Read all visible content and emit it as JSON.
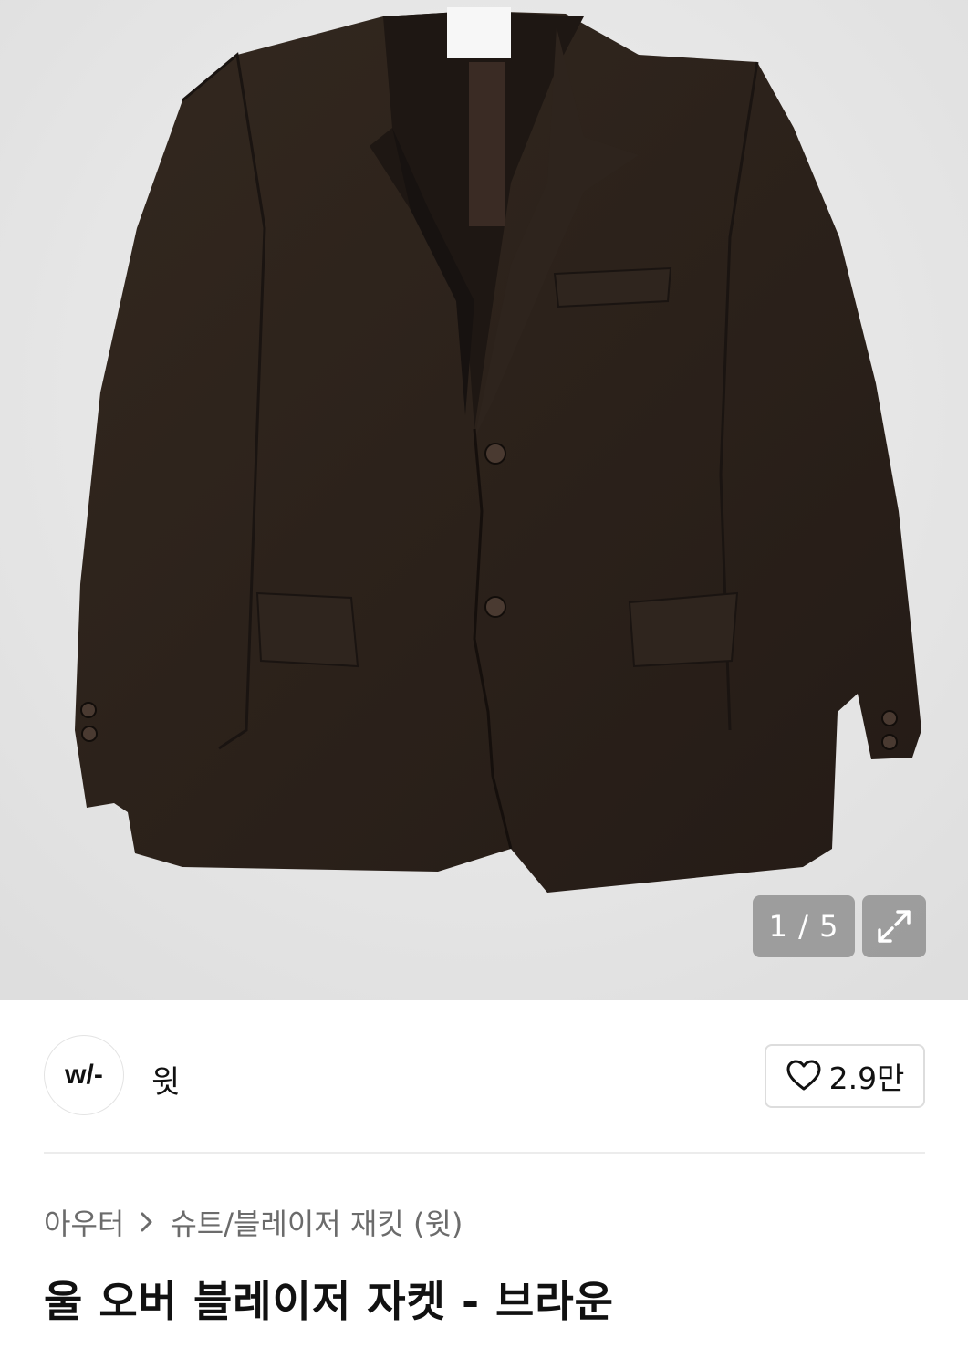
{
  "product_image": {
    "description_icon": "jacket-photo",
    "counter_current": "1",
    "counter_total": "5",
    "counter_text": "1 / 5",
    "expand_icon": "expand-icon"
  },
  "brand": {
    "logo_text": "w/-",
    "name": "윗"
  },
  "like": {
    "icon": "heart-icon",
    "count": "2.9만"
  },
  "breadcrumb": {
    "items": [
      "아우터",
      "슈트/블레이저 재킷 (윗)"
    ],
    "separator_icon": "chevron-right-icon"
  },
  "product": {
    "title": "울 오버 블레이저 자켓 - 브라운"
  },
  "colors": {
    "hero_bg": "#e9e9e9",
    "jacket": "#2b211b",
    "overlay": "#828282",
    "text_secondary": "#6b6b6b"
  }
}
